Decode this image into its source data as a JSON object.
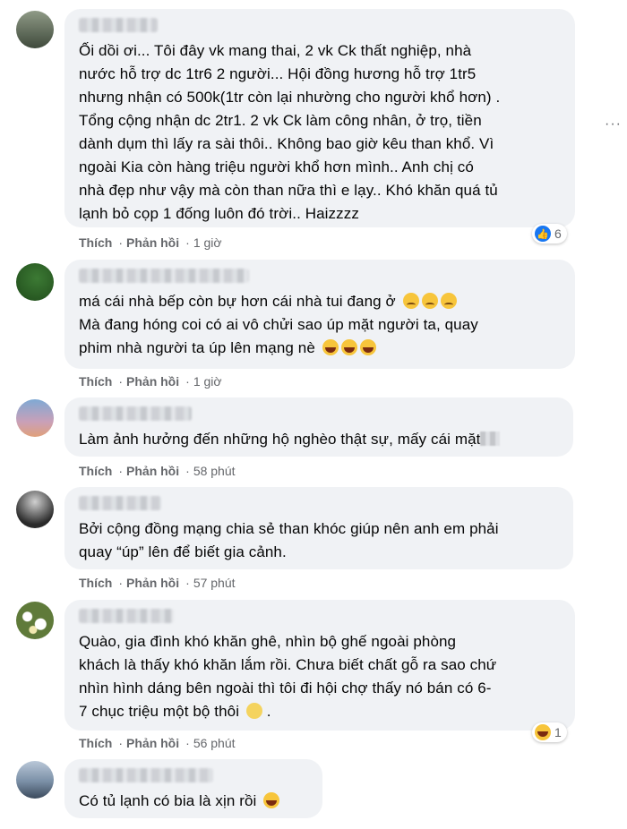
{
  "comments": [
    {
      "text": "Ối dồi ơi... Tôi đây vk mang thai, 2 vk Ck thất nghiệp, nhà\nnước hỗ trợ dc 1tr6 2 người... Hội đồng hương hỗ trợ 1tr5\nnhưng nhận có 500k(1tr còn lại nhường cho người khổ hơn) .\nTổng cộng nhận dc 2tr1. 2 vk Ck làm công nhân, ở trọ, tiền\ndành dụm thì lấy ra sài thôi.. Không bao giờ kêu than khổ. Vì\nngoài Kia còn hàng triệu người khổ hơn mình.. Anh chị có\nnhà đẹp như vậy mà còn than nữa thì e lạy.. Khó khăn quá tủ\nlạnh bỏ cọp 1 đống luôn đó trời.. Haizzzz",
      "like": "Thích",
      "reply": "Phản hồi",
      "time": "1 giờ",
      "reaction_count": "6"
    },
    {
      "text": "má cái nhà bếp còn bự hơn cái nhà tui đang ở",
      "text2": "Mà đang hóng coi có ai vô chửi sao úp mặt người ta, quay\nphim nhà người ta úp lên mạng nè",
      "like": "Thích",
      "reply": "Phản hồi",
      "time": "1 giờ"
    },
    {
      "text": "Làm ảnh hưởng đến những hộ nghèo thật sự, mấy cái mặt",
      "like": "Thích",
      "reply": "Phản hồi",
      "time": "58 phút"
    },
    {
      "text": "Bởi cộng đồng mạng chia sẻ than khóc giúp nên anh em phải\nquay “úp” lên để biết gia cảnh.",
      "like": "Thích",
      "reply": "Phản hồi",
      "time": "57 phút"
    },
    {
      "text": "Quào, gia đình khó khăn ghê, nhìn bộ ghế ngoài phòng\nkhách là thấy khó khăn lắm rồi. Chưa biết chất gỗ ra sao chứ\nnhìn hình dáng bên ngoài thì tôi đi hội chợ thấy nó bán có 6-\n7 chục triệu một bộ thôi",
      "like": "Thích",
      "reply": "Phản hồi",
      "time": "56 phút",
      "reaction_count": "1"
    },
    {
      "text": "Có tủ lạnh có bia là xịn rồi"
    }
  ],
  "more_menu": "···"
}
